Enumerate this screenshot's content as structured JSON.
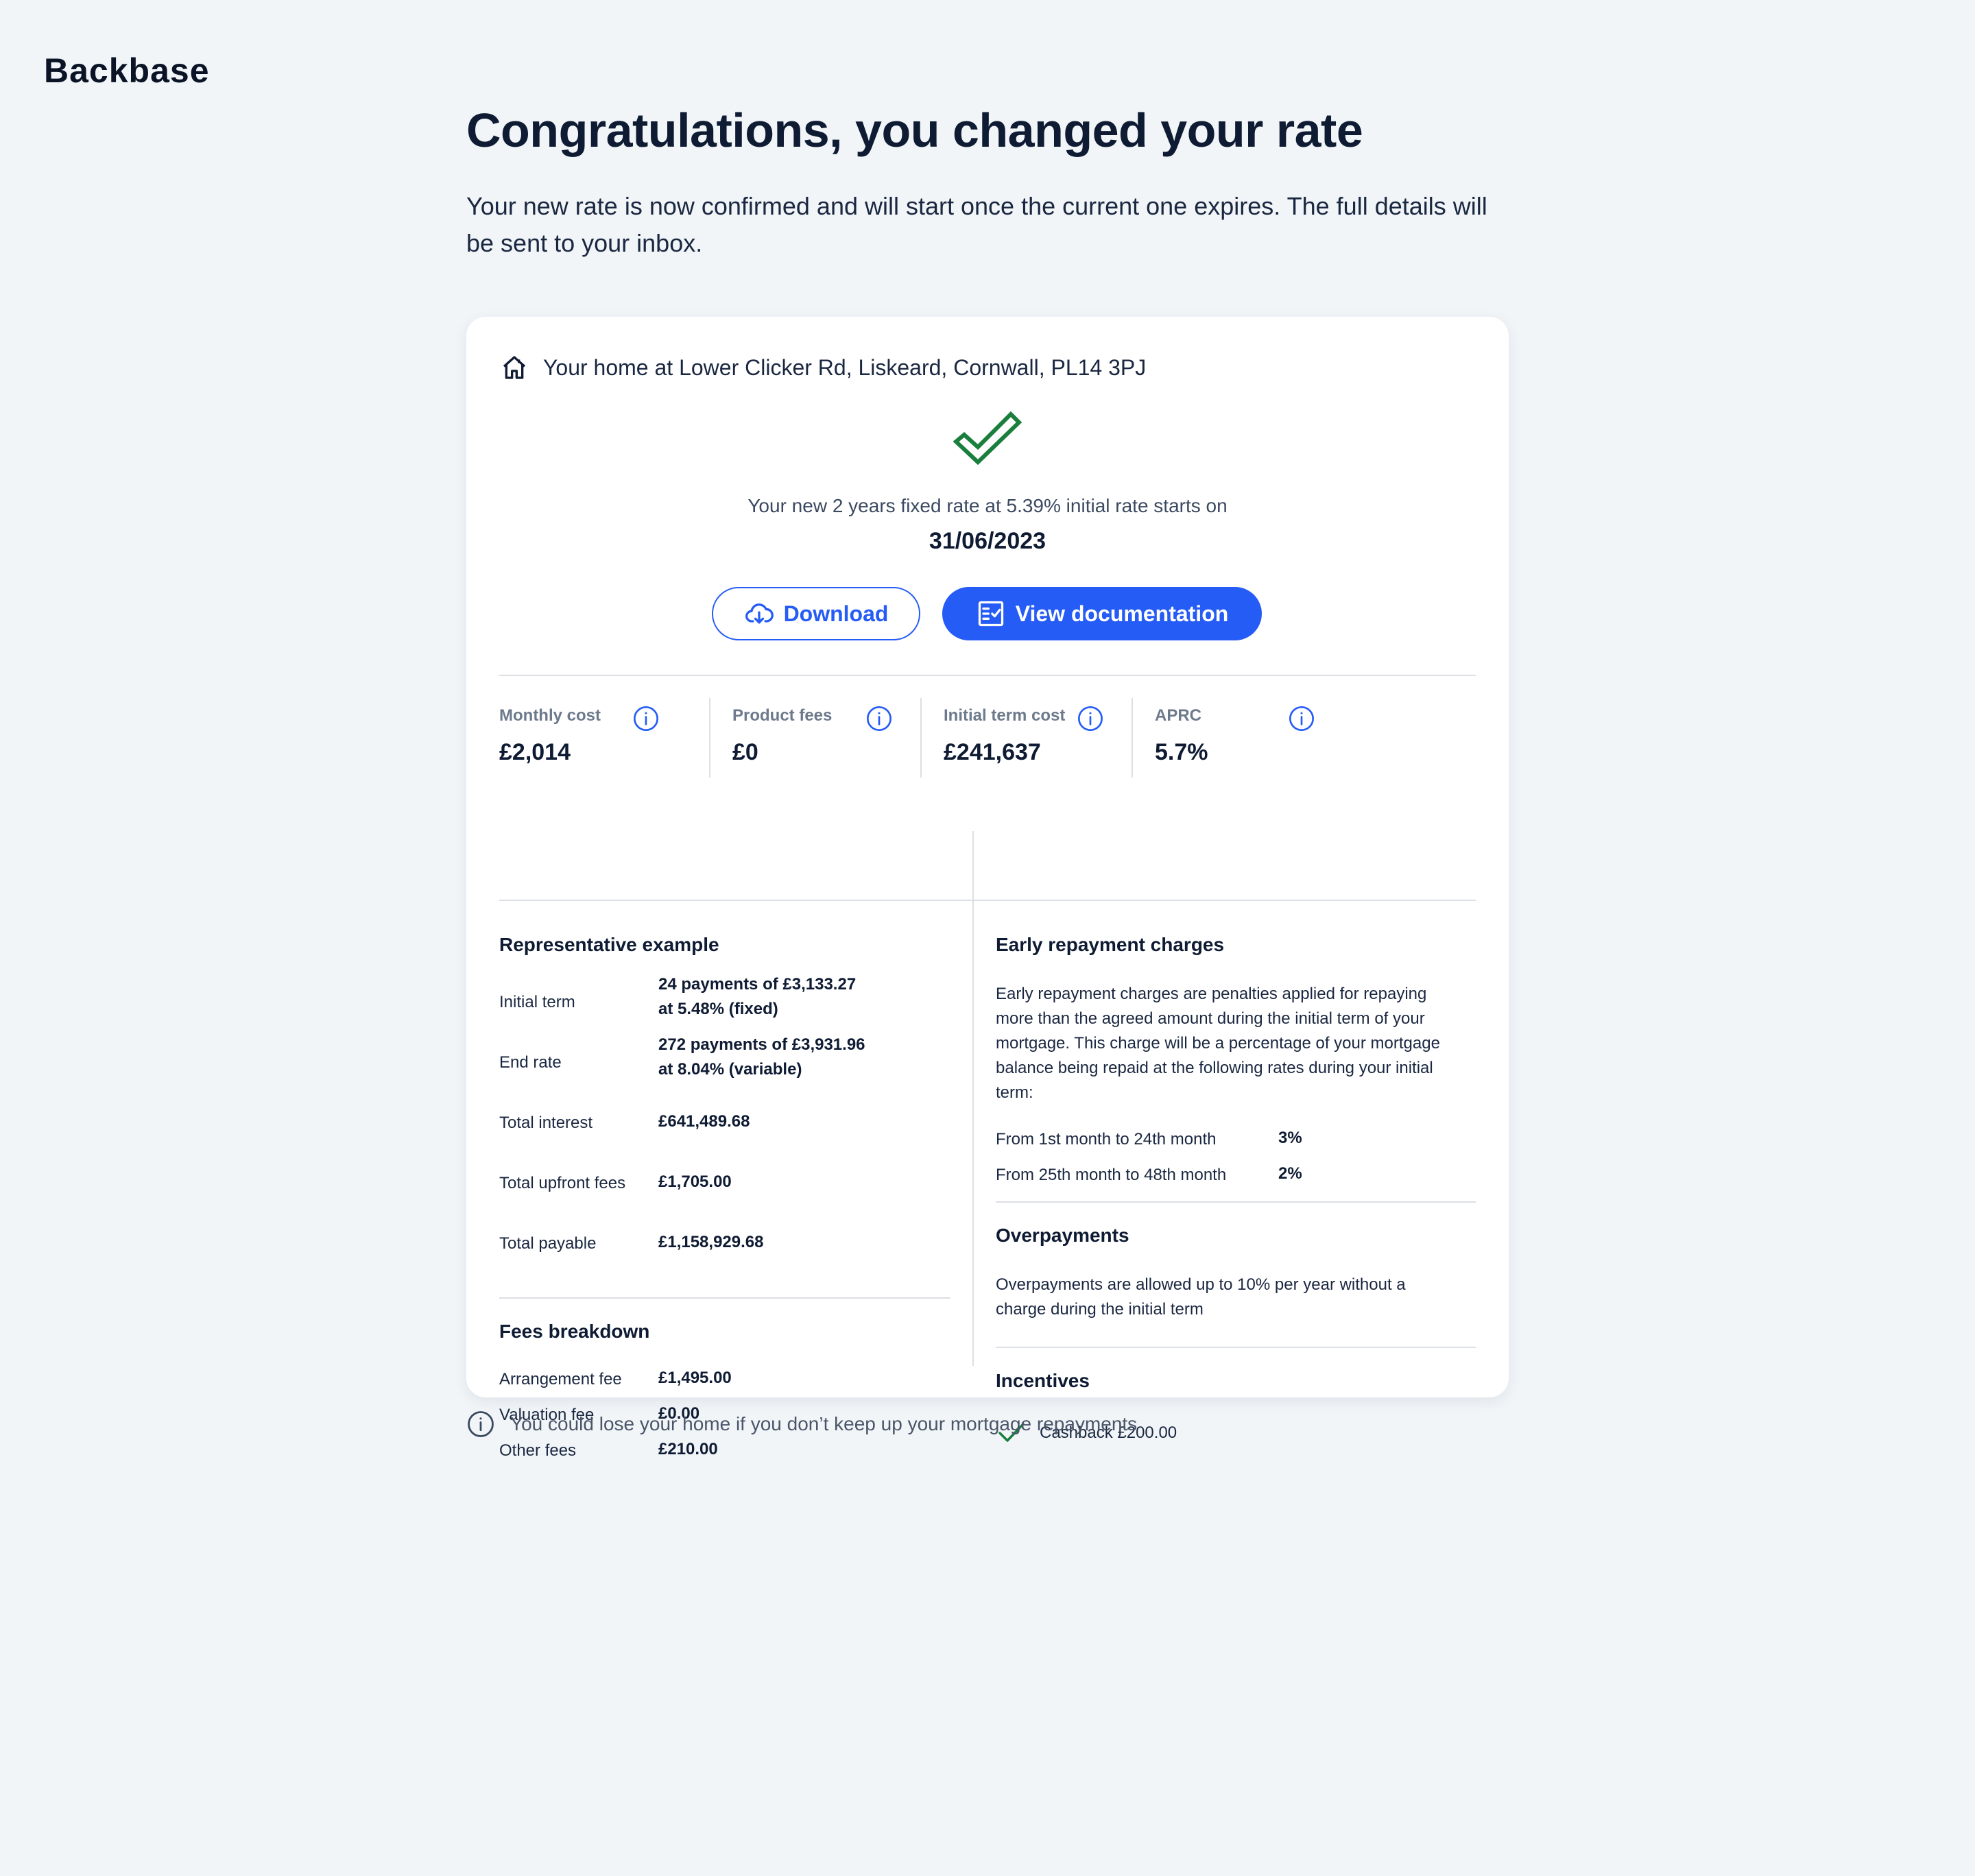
{
  "brand": {
    "logo_text": "Backbase"
  },
  "header": {
    "title": "Congratulations, you changed your rate",
    "subtitle": "Your new rate is now confirmed and will start once the current one expires. The full details will be sent to your inbox."
  },
  "card": {
    "home_icon": "home-icon",
    "address": "Your home at Lower Clicker Rd, Liskeard, Cornwall, PL14 3PJ",
    "rate_line": "Your new 2 years fixed rate at 5.39% initial rate starts on",
    "start_date": "31/06/2023",
    "download_label": "Download",
    "docs_label": "View documentation",
    "stats": [
      {
        "label": "Monthly cost",
        "value": "£2,014"
      },
      {
        "label": "Product fees",
        "value": "£0"
      },
      {
        "label": "Initial term cost",
        "value": "£241,637"
      },
      {
        "label": "APRC",
        "value": "5.7%"
      }
    ],
    "representative": {
      "title": "Representative example",
      "rows": [
        {
          "label": "Initial term",
          "value1": "24 payments of £3,133.27",
          "value2": "at 5.48% (fixed)"
        },
        {
          "label": "End rate",
          "value1": "272 payments of £3,931.96",
          "value2": "at 8.04% (variable)"
        },
        {
          "label": "Total interest",
          "value1": "£641,489.68"
        },
        {
          "label": "Total upfront fees",
          "value1": "£1,705.00"
        },
        {
          "label": "Total payable",
          "value1": "£1,158,929.68"
        }
      ]
    },
    "fees": {
      "title": "Fees breakdown",
      "rows": [
        {
          "label": "Arrangement fee",
          "value": "£1,495.00"
        },
        {
          "label": "Valuation fee",
          "value": "£0.00"
        },
        {
          "label": "Other fees",
          "value": "£210.00"
        }
      ]
    },
    "early_repayment": {
      "title": "Early repayment charges",
      "lines": [
        "Early repayment charges are penalties applied for repaying",
        "more than the agreed amount during the initial term of your",
        "mortgage. This charge will be a percentage of your mortgage",
        "balance being repaid at the following rates during your initial",
        "term:"
      ],
      "rows": [
        {
          "label": "From 1st month to 24th month",
          "value": "3%"
        },
        {
          "label": "From 25th month to 48th month",
          "value": "2%"
        }
      ]
    },
    "overpayments": {
      "title": "Overpayments",
      "lines": [
        "Overpayments are allowed up to 10% per year without a",
        "charge during the initial term"
      ]
    },
    "incentives": {
      "title": "Incentives",
      "item": "Cashback £200.00"
    }
  },
  "disclaimer": "You could lose your home if you don’t keep up your mortgage repayments",
  "colors": {
    "accent": "#255cf5",
    "success": "#1a7f3c",
    "text": "#0e1b33",
    "background": "#f1f5f8"
  }
}
